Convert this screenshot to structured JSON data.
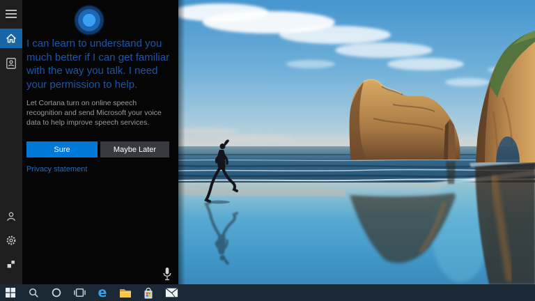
{
  "colors": {
    "accent": "#0078d7",
    "secondary_button": "#36393f",
    "heading_blue": "#1e55a6",
    "link_blue": "#2a6ab5",
    "sidebar_bg": "#1e1e1e",
    "panel_bg": "#050505",
    "home_selected_bg": "#1767a8",
    "taskbar_bg": "#1b2936"
  },
  "sidebar": {
    "top_items": [
      {
        "id": "menu",
        "icon": "hamburger-menu-icon",
        "selected": false
      },
      {
        "id": "home",
        "icon": "home-icon",
        "selected": true
      },
      {
        "id": "notebook",
        "icon": "notebook-icon",
        "selected": false
      }
    ],
    "bottom_items": [
      {
        "id": "profile",
        "icon": "user-icon"
      },
      {
        "id": "settings",
        "icon": "gear-icon"
      },
      {
        "id": "feedback",
        "icon": "feedback-icon"
      }
    ]
  },
  "cortana": {
    "orb_icon": "cortana-orb",
    "heading": "I can learn to understand you much better if I can get familiar with the way you talk. I need your permission to help.",
    "description": "Let Cortana turn on online speech recognition and send Microsoft your voice data to help improve speech services.",
    "primary_button": "Sure",
    "secondary_button": "Maybe Later",
    "privacy_link": "Privacy statement",
    "mic_icon": "microphone-icon"
  },
  "taskbar": {
    "edge_glyph": "e",
    "items": [
      {
        "id": "start",
        "icon": "windows-start-icon"
      },
      {
        "id": "search",
        "icon": "search-icon"
      },
      {
        "id": "cortana",
        "icon": "cortana-circle-icon"
      },
      {
        "id": "task-view",
        "icon": "task-view-icon"
      },
      {
        "id": "edge",
        "icon": "edge-icon"
      },
      {
        "id": "file-explorer",
        "icon": "folder-icon"
      },
      {
        "id": "store",
        "icon": "store-icon"
      },
      {
        "id": "mail",
        "icon": "mail-icon"
      }
    ]
  }
}
